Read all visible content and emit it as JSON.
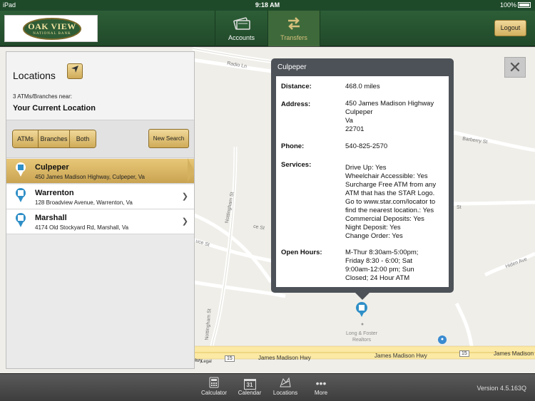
{
  "status": {
    "carrier": "iPad",
    "time": "9:18 AM",
    "battery": "100%"
  },
  "header": {
    "logo_name": "OAK VIEW",
    "logo_sub": "NATIONAL BANK",
    "tabs": [
      {
        "label": "Accounts"
      },
      {
        "label": "Transfers"
      }
    ],
    "logout": "Logout"
  },
  "panel": {
    "title": "Locations",
    "count": "3 ATMs/Branches near:",
    "near": "Your Current Location",
    "filters": [
      "ATMs",
      "Branches",
      "Both"
    ],
    "new_search": "New Search",
    "items": [
      {
        "name": "Culpeper",
        "address": "450 James Madison Highway, Culpeper, Va"
      },
      {
        "name": "Warrenton",
        "address": "128 Broadview Avenue, Warrenton, Va"
      },
      {
        "name": "Marshall",
        "address": "4174 Old Stockyard Rd, Marshall, Va"
      }
    ]
  },
  "popup": {
    "title": "Culpeper",
    "distance_label": "Distance:",
    "distance": "468.0 miles",
    "address_label": "Address:",
    "address_lines": [
      "450 James Madison Highway",
      "Culpeper",
      "Va",
      "22701"
    ],
    "phone_label": "Phone:",
    "phone": "540-825-2570",
    "services_label": "Services:",
    "services_lines": [
      "Drive Up: Yes",
      "Wheelchair Accessible: Yes",
      "Surcharge Free ATM from any",
      "ATM that has the STAR Logo.",
      "Go to  www.star.com/locator to",
      "find the nearest location.: Yes",
      "Commercial Deposits: Yes",
      "Night Deposit: Yes",
      "Change Order: Yes"
    ],
    "hours_label": "Open Hours:",
    "hours_lines": [
      "M-Thur 8:30am-5:00pm;",
      "Friday 8:30 - 6:00; Sat",
      "9:00am-12:00 pm; Sun",
      "Closed;  24 Hour ATM"
    ]
  },
  "map": {
    "labels": {
      "radio": "Radio Ln",
      "barberry": "Barberry St",
      "nottingham1": "Nottingham St",
      "nottingham2": "Nottingham St",
      "uce": "uce St",
      "ce": "ce St",
      "st": "St",
      "hiden": "Hiden Ave",
      "jm1": "James Madison Hwy",
      "jm2": "James Madison Hwy",
      "jm3": "James Madison",
      "route15a": "15",
      "route15b": "15",
      "hwy": "Hwy",
      "legal": "Legal",
      "poi": "Long & Foster Realtors"
    }
  },
  "bottom": {
    "tabs": [
      {
        "label": "Calculator"
      },
      {
        "label": "Calendar"
      },
      {
        "label": "Locations"
      },
      {
        "label": "More"
      }
    ],
    "calendar_day": "31",
    "version": "Version 4.5.163Q"
  }
}
